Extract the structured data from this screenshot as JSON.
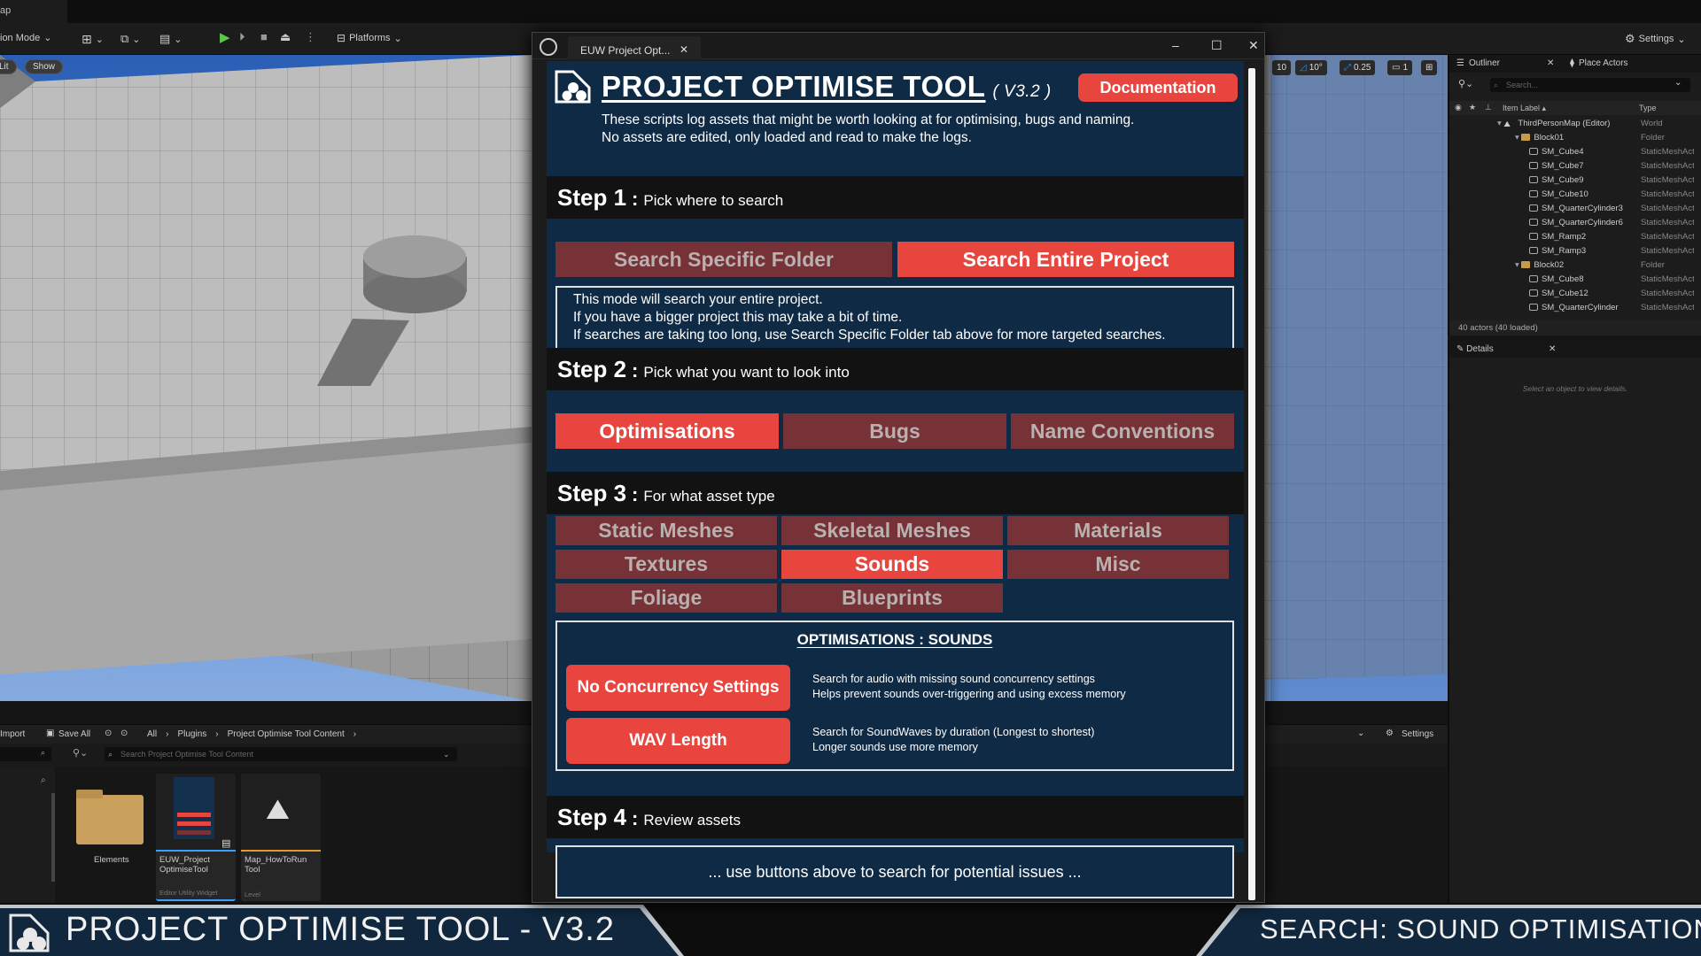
{
  "menubar": {
    "title": "ap"
  },
  "toolbar": {
    "mode": "ion Mode",
    "platforms": "Platforms",
    "settings": "Settings"
  },
  "viewport": {
    "lit": "Lit",
    "show": "Show",
    "grid": "10",
    "angle": "10°",
    "scale": "0.25",
    "cam": "1"
  },
  "outliner": {
    "tab": "Outliner",
    "place_tab": "Place Actors",
    "search_placeholder": "Search...",
    "col_label": "Item Label ▴",
    "col_type": "Type",
    "rows": [
      {
        "name": "ThirdPersonMap (Editor)",
        "type": "World"
      },
      {
        "name": "Block01",
        "type": "Folder"
      },
      {
        "name": "SM_Cube4",
        "type": "StaticMeshActor"
      },
      {
        "name": "SM_Cube7",
        "type": "StaticMeshActor"
      },
      {
        "name": "SM_Cube9",
        "type": "StaticMeshActor"
      },
      {
        "name": "SM_Cube10",
        "type": "StaticMeshActor"
      },
      {
        "name": "SM_QuarterCylinder3",
        "type": "StaticMeshActor"
      },
      {
        "name": "SM_QuarterCylinder6",
        "type": "StaticMeshActor"
      },
      {
        "name": "SM_Ramp2",
        "type": "StaticMeshActor"
      },
      {
        "name": "SM_Ramp3",
        "type": "StaticMeshActor"
      },
      {
        "name": "Block02",
        "type": "Folder"
      },
      {
        "name": "SM_Cube8",
        "type": "StaticMeshActor"
      },
      {
        "name": "SM_Cube12",
        "type": "StaticMeshActor"
      },
      {
        "name": "SM_QuarterCylinder",
        "type": "StaticMeshActor"
      }
    ],
    "count": "40 actors (40 loaded)"
  },
  "details": {
    "tab": "Details",
    "hint": "Select an object to view details."
  },
  "content_browser": {
    "import": "Import",
    "save_all": "Save All",
    "breadcrumb": [
      "All",
      "Plugins",
      "Project Optimise Tool Content"
    ],
    "settings": "Settings",
    "search_placeholder": "Search Project Optimise Tool Content",
    "assets": [
      {
        "name": "Elements",
        "type": ""
      },
      {
        "name": "EUW_Project OptimiseTool",
        "type": "Editor Utility Widget"
      },
      {
        "name": "Map_HowToRun Tool",
        "type": "Level"
      }
    ]
  },
  "window": {
    "tab_title": "EUW Project Opt...",
    "min": "–",
    "max": "☐",
    "close": "✕"
  },
  "tool": {
    "title": "PROJECT OPTIMISE TOOL",
    "version": "( V3.2 )",
    "doc_button": "Documentation",
    "desc_line1": "These scripts log assets that might be worth looking at for optimising, bugs and naming.",
    "desc_line2": "No assets are edited, only loaded and read to make the logs.",
    "step1": {
      "label": "Step 1",
      "colon": ":",
      "text": "Pick where to search"
    },
    "search_folder": "Search Specific Folder",
    "search_project": "Search Entire Project",
    "mode_info": [
      "This mode will search your entire project.",
      "If you have a bigger project this may take a bit of time.",
      "If searches are taking too long, use Search Specific Folder tab above for more targeted searches."
    ],
    "step2": {
      "label": "Step 2",
      "colon": ":",
      "text": "Pick what you want to look into"
    },
    "cat_opt": "Optimisations",
    "cat_bugs": "Bugs",
    "cat_names": "Name Conventions",
    "step3": {
      "label": "Step 3",
      "colon": ":",
      "text": "For what asset type"
    },
    "types": {
      "static": "Static Meshes",
      "skeletal": "Skeletal Meshes",
      "materials": "Materials",
      "textures": "Textures",
      "sounds": "Sounds",
      "misc": "Misc",
      "foliage": "Foliage",
      "blueprints": "Blueprints"
    },
    "panel_title": "OPTIMISATIONS : SOUNDS",
    "action1": {
      "label": "No Concurrency Settings",
      "d1": "Search for audio with missing sound concurrency settings",
      "d2": "Helps prevent sounds over-triggering and using excess memory"
    },
    "action2": {
      "label": "WAV Length",
      "d1": "Search for SoundWaves by duration (Longest to shortest)",
      "d2": "Longer sounds use more memory"
    },
    "step4": {
      "label": "Step 4",
      "colon": ":",
      "text": "Review assets"
    },
    "review": "... use buttons above to search for potential issues ..."
  },
  "banner": {
    "left": "PROJECT OPTIMISE TOOL  -  V3.2",
    "right": "SEARCH: SOUND OPTIMISATIONS"
  },
  "colors": {
    "accent": "#e8453f",
    "inactive": "#763236",
    "navy": "#0e2a45"
  }
}
